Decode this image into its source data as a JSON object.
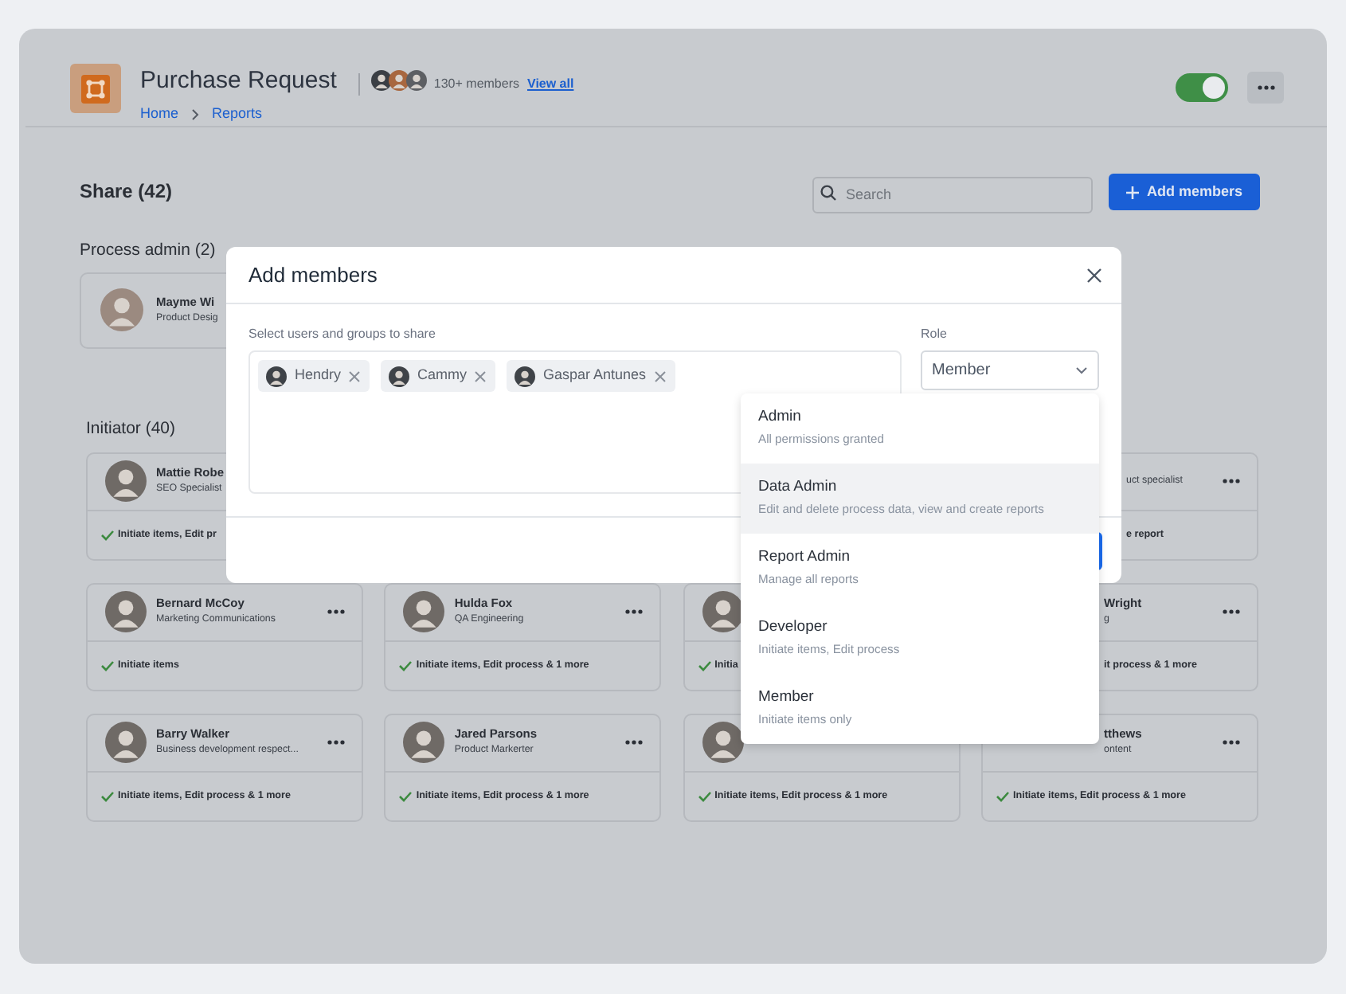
{
  "header": {
    "title": "Purchase Request",
    "members_count": "130+ members",
    "view_all": "View all",
    "breadcrumbs": [
      {
        "label": "Home"
      },
      {
        "label": "Reports"
      }
    ],
    "toggle": {
      "on": true
    }
  },
  "share": {
    "title": "Share (42)",
    "search": {
      "placeholder": "Search"
    },
    "add_button": "Add members"
  },
  "process_admin": {
    "title": "Process admin (2)",
    "members": [
      {
        "avatar": true,
        "name": "Mayme Wi",
        "role": "Product Desig"
      }
    ]
  },
  "initiator": {
    "title": "Initiator (40)",
    "rows": [
      {
        "members": [
          {
            "avatar": true,
            "name": "Mattie Robe",
            "role": "SEO Specialist",
            "check": true,
            "permissions": "Initiate items, Edit pr"
          },
          {
            "role": "uct specialist",
            "permissions": "e report",
            "more": true
          }
        ]
      },
      {
        "members": [
          {
            "avatar": true,
            "name": "Bernard McCoy",
            "role": "Marketing Communications",
            "check": true,
            "permissions": "Initiate items",
            "more": true
          },
          {
            "avatar": true,
            "name": "Hulda Fox",
            "role": "QA Engineering",
            "check": true,
            "permissions": "Initiate items, Edit process & 1 more",
            "more": true
          },
          {
            "avatar": true,
            "check": true,
            "permissions": "Initia"
          },
          {
            "name": "Wright",
            "role": "g",
            "permissions": "it process & 1 more",
            "more": true
          }
        ]
      },
      {
        "members": [
          {
            "avatar": true,
            "name": "Barry Walker",
            "role": "Business development respect...",
            "check": true,
            "permissions": "Initiate items, Edit process & 1 more",
            "more": true
          },
          {
            "avatar": true,
            "name": "Jared Parsons",
            "role": "Product Markerter",
            "check": true,
            "permissions": "Initiate items, Edit process & 1 more",
            "more": true
          },
          {
            "avatar": true,
            "check": true,
            "permissions": "Initiate items, Edit process & 1 more"
          },
          {
            "name": "tthews",
            "role": "ontent",
            "check": true,
            "permissions": "Initiate items, Edit process & 1 more",
            "more": true
          }
        ]
      }
    ]
  },
  "modal": {
    "title": "Add members",
    "users_label": "Select users and groups to share",
    "selected": [
      {
        "name": "Hendry"
      },
      {
        "name": "Cammy"
      },
      {
        "name": "Gaspar Antunes"
      }
    ],
    "role_label": "Role",
    "role_value": "Member",
    "role_options": [
      {
        "title": "Admin",
        "description": "All permissions granted",
        "highlighted": false
      },
      {
        "title": "Data Admin",
        "description": "Edit and delete process data, view and create reports",
        "highlighted": true
      },
      {
        "title": "Report Admin",
        "description": "Manage all reports",
        "highlighted": false
      },
      {
        "title": "Developer",
        "description": "Initiate items, Edit process",
        "highlighted": false
      },
      {
        "title": "Member",
        "description": "Initiate items only",
        "highlighted": false
      }
    ]
  }
}
